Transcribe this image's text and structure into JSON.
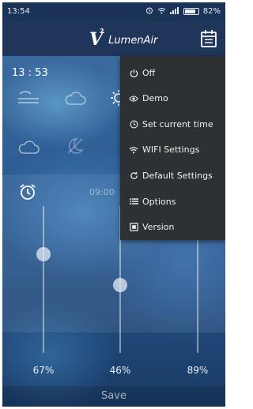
{
  "status_bar": {
    "time": "13:54",
    "battery": "82%",
    "battery_level": 0.82
  },
  "app_bar": {
    "logo_letter": "V",
    "logo_superscript": "2",
    "logo_text": "LumenAir",
    "calendar_icon": "calendar-icon"
  },
  "main": {
    "current_time": "13 : 53",
    "alarm_time": "09:00",
    "sliders": [
      {
        "label": "67%",
        "value": 0.67
      },
      {
        "label": "46%",
        "value": 0.46
      },
      {
        "label": "89%",
        "value": 0.89
      }
    ],
    "save_label": "Save"
  },
  "menu": {
    "items": [
      {
        "label": "Off",
        "icon": "power-icon"
      },
      {
        "label": "Demo",
        "icon": "eye-icon"
      },
      {
        "label": "Set current time",
        "icon": "clock-icon"
      },
      {
        "label": "WIFI Settings",
        "icon": "wifi-icon"
      },
      {
        "label": "Default Settings",
        "icon": "refresh-icon"
      },
      {
        "label": "Options",
        "icon": "list-icon"
      },
      {
        "label": "Version",
        "icon": "version-icon"
      }
    ]
  },
  "colors": {
    "app_bar": "#1f355a",
    "menu_bg": "#2e3133",
    "text": "#f0f0f0"
  }
}
